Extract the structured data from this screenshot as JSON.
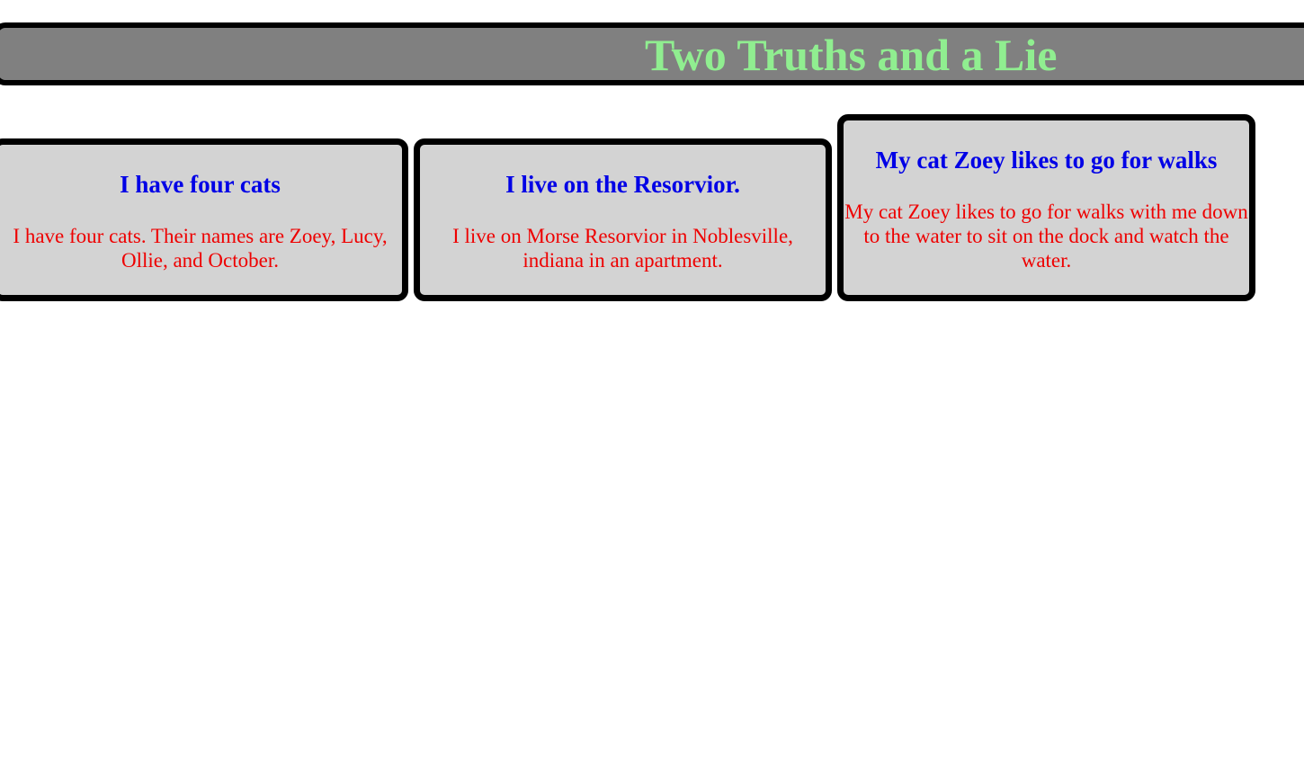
{
  "header": {
    "title": "Two Truths and a Lie"
  },
  "cards": [
    {
      "heading": "I have four cats",
      "text": "I have four cats. Their names are Zoey, Lucy, Ollie, and October."
    },
    {
      "heading": "I live on the Resorvior.",
      "text": "I live on Morse Resorvior in Noblesville, indiana in an apartment."
    },
    {
      "heading": "My cat Zoey likes to go for walks",
      "text": "My cat Zoey likes to go for walks with me down to the water to sit on the dock and watch the water."
    }
  ],
  "colors": {
    "header_background": "#808080",
    "header_title": "#90ee90",
    "card_background": "#d3d3d3",
    "card_heading": "#0000e6",
    "card_text": "#ee0000",
    "border": "#000000"
  }
}
